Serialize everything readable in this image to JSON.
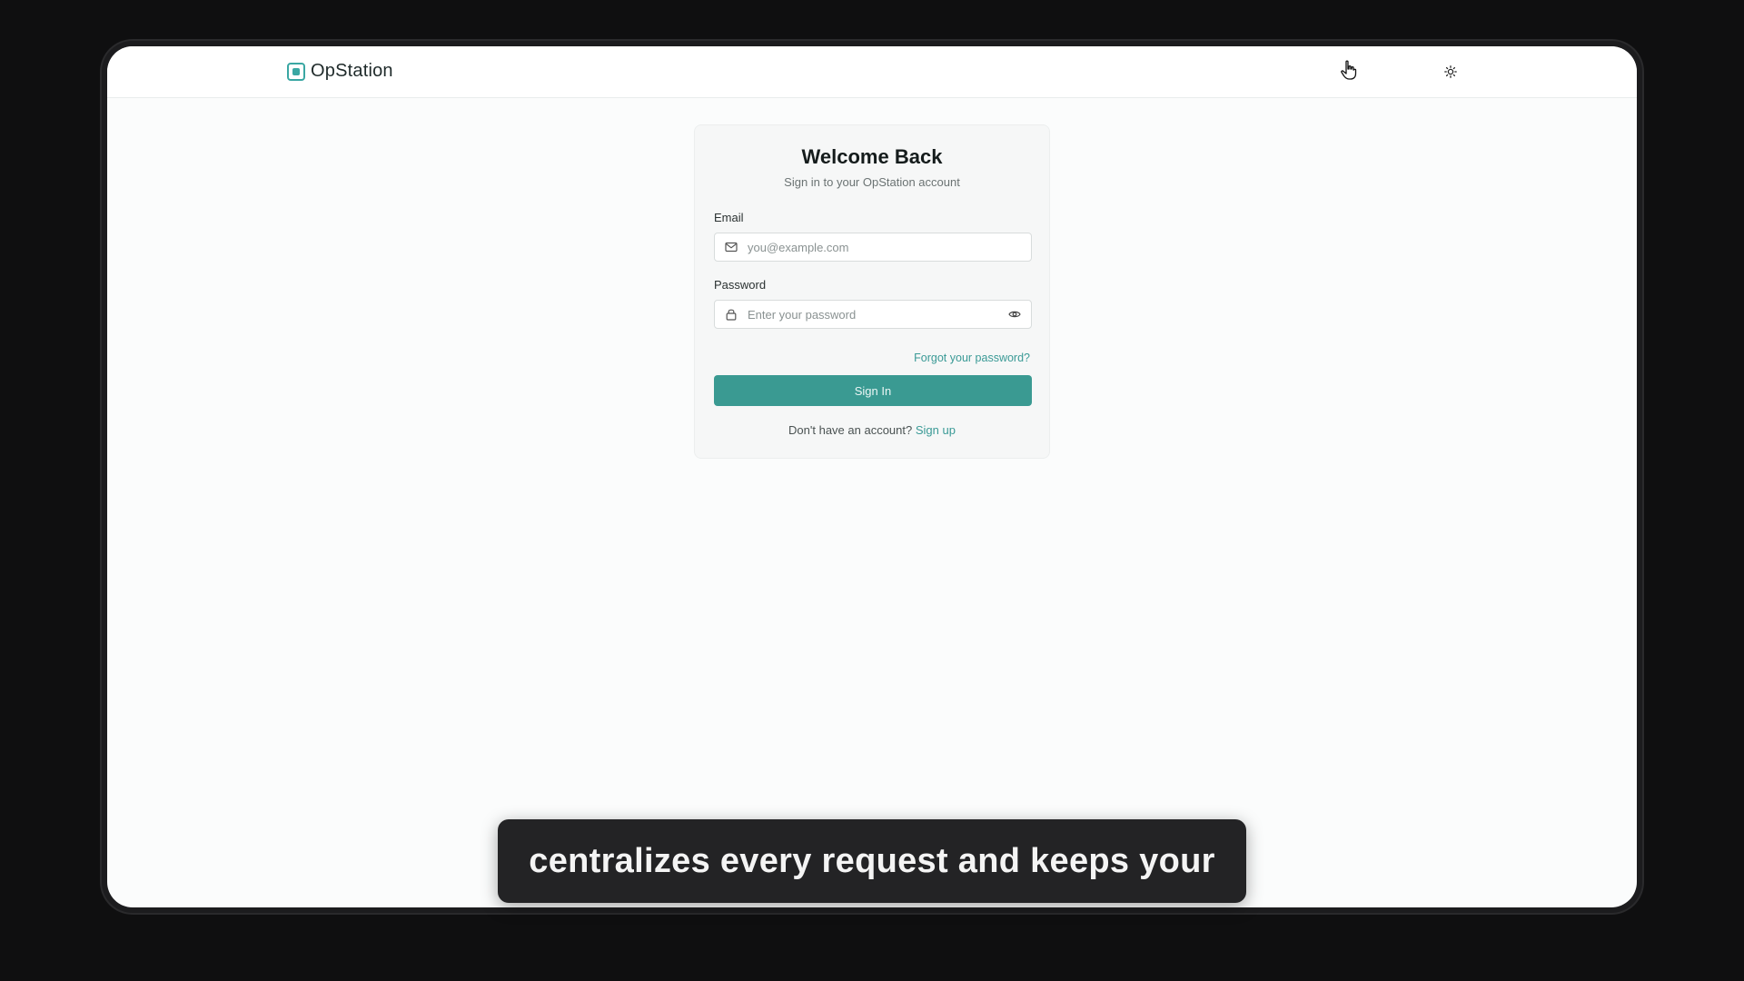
{
  "app": {
    "brand_name": "OpStation"
  },
  "header": {
    "theme_toggle_icon": "sun-icon",
    "cursor_icon": "hand-pointer-icon"
  },
  "login": {
    "title": "Welcome Back",
    "subtitle": "Sign in to your OpStation account",
    "email": {
      "label": "Email",
      "placeholder": "you@example.com",
      "value": "",
      "icon": "mail-icon"
    },
    "password": {
      "label": "Password",
      "placeholder": "Enter your password",
      "value": "",
      "icon": "lock-icon",
      "toggle_icon": "eye-icon"
    },
    "forgot_link": "Forgot your password?",
    "submit_label": "Sign In",
    "signup_prompt": "Don't have an account?",
    "signup_link": "Sign up"
  },
  "caption": {
    "text": "centralizes every request and keeps your"
  },
  "colors": {
    "accent": "#3a9a92",
    "link": "#3a9a96",
    "brand": "#3aa7a3",
    "page_bg": "#0f0f10",
    "screen_bg": "#fbfcfc"
  }
}
